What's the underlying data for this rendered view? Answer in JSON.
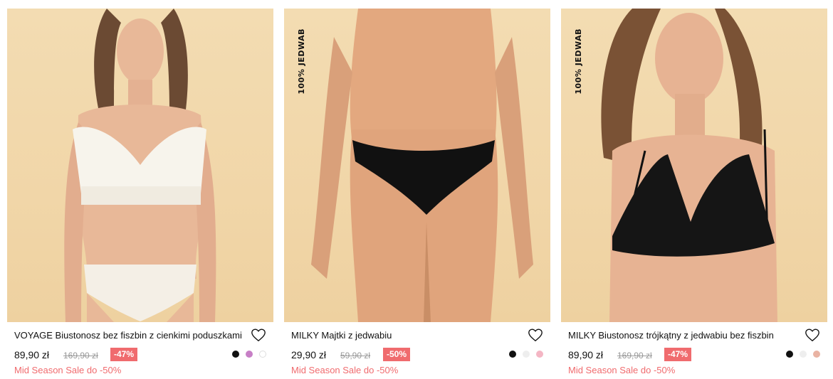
{
  "products": [
    {
      "badge": "",
      "title": "VOYAGE Biustonosz bez fiszbin z cienkimi poduszkami",
      "price": "89,90 zł",
      "old_price": "169,90 zł",
      "discount": "-47%",
      "promo": "Mid Season Sale do -50%",
      "swatches": [
        "#111111",
        "#c77fc6",
        "#ffffff"
      ]
    },
    {
      "badge": "100% JEDWAB",
      "title": "MILKY Majtki z jedwabiu",
      "price": "29,90 zł",
      "old_price": "59,90 zł",
      "discount": "-50%",
      "promo": "Mid Season Sale do -50%",
      "swatches": [
        "#111111",
        "#eeeeee",
        "#f4b6c4"
      ]
    },
    {
      "badge": "100% JEDWAB",
      "title": "MILKY Biustonosz trójkątny z jedwabiu bez fiszbin",
      "price": "89,90 zł",
      "old_price": "169,90 zł",
      "discount": "-47%",
      "promo": "Mid Season Sale do -50%",
      "swatches": [
        "#111111",
        "#eeeeee",
        "#e9b3a3"
      ]
    }
  ],
  "colors": {
    "accent": "#f06b6e",
    "image_bg": "#f2d8ab"
  },
  "icons": {
    "wishlist": "heart-outline-icon"
  }
}
